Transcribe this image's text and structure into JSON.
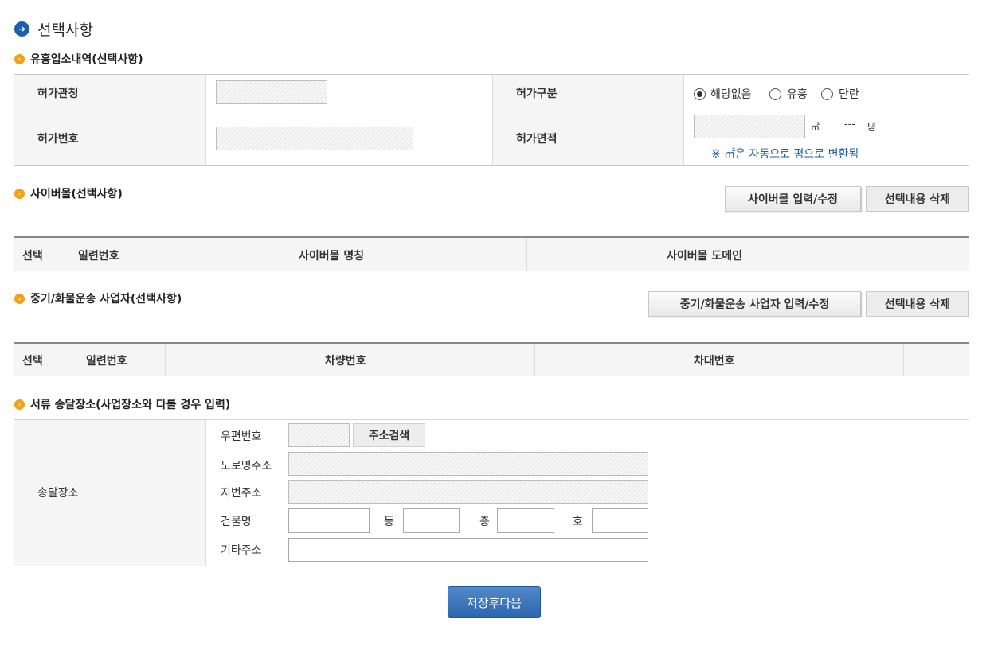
{
  "page": {
    "title": "선택사항",
    "arrow_icon": "arrow-right-icon"
  },
  "sections": {
    "business": {
      "title": "유흥업소내역(선택사항)",
      "license_agency_label": "허가관청",
      "license_type_label": "허가구분",
      "license_type_options": [
        "해당없음",
        "유흥",
        "단란"
      ],
      "license_type_selected": "해당없음",
      "license_number_label": "허가번호",
      "license_area_label": "허가면적",
      "area_unit_m2": "㎡",
      "area_pyeong_value": "---",
      "area_pyeong_unit": "평",
      "area_note": "※ ㎡은 자동으로 평으로 변환됨"
    },
    "cybermall": {
      "title": "사이버몰(선택사항)",
      "input_button": "사이버몰 입력/수정",
      "delete_button": "선택내용 삭제",
      "columns": [
        "선택",
        "일련번호",
        "사이버몰 명칭",
        "사이버몰 도메인",
        ""
      ]
    },
    "heavy": {
      "title": "중기/화물운송 사업자(선택사항)",
      "input_button": "중기/화물운송 사업자 입력/수정",
      "delete_button": "선택내용 삭제",
      "columns": [
        "선택",
        "일련번호",
        "차량번호",
        "차대번호",
        ""
      ]
    },
    "delivery": {
      "title": "서류 송달장소(사업장소와 다를 경우 입력)",
      "row_label": "송달장소",
      "postal_label": "우편번호",
      "address_search_button": "주소검색",
      "road_address_label": "도로명주소",
      "lot_address_label": "지번주소",
      "building_label": "건물명",
      "dong_label": "동",
      "floor_label": "층",
      "ho_label": "호",
      "other_address_label": "기타주소"
    }
  },
  "footer": {
    "save_next_button": "저장후다음"
  },
  "colors": {
    "accent_blue": "#2c66ad",
    "bullet_orange": "#f0a218"
  }
}
